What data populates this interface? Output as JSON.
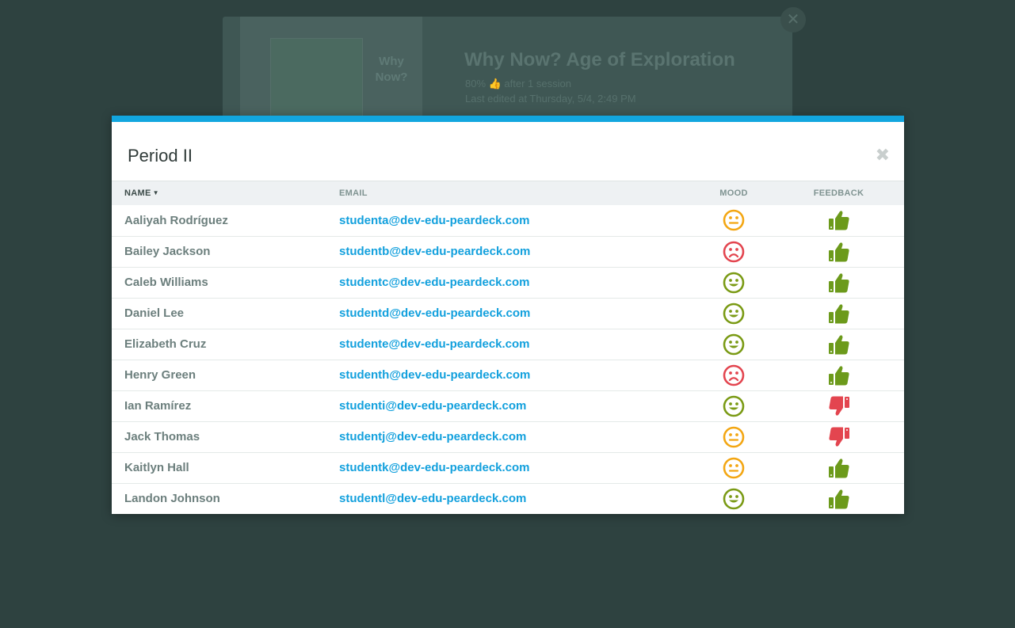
{
  "background": {
    "thumb_label": "Why Now?",
    "title": "Why Now? Age of Exploration",
    "meta_line1": "80% 👍 after 1 session",
    "meta_line2": "Last edited at Thursday, 5/4, 2:49 PM"
  },
  "modal": {
    "title": "Period II",
    "columns": {
      "name": "NAME",
      "email": "EMAIL",
      "mood": "MOOD",
      "feedback": "FEEDBACK"
    },
    "rows": [
      {
        "name": "Aaliyah Rodríguez",
        "email": "studenta@dev-edu-peardeck.com",
        "mood": "neutral",
        "feedback": "up"
      },
      {
        "name": "Bailey Jackson",
        "email": "studentb@dev-edu-peardeck.com",
        "mood": "sad",
        "feedback": "up"
      },
      {
        "name": "Caleb Williams",
        "email": "studentc@dev-edu-peardeck.com",
        "mood": "happy",
        "feedback": "up"
      },
      {
        "name": "Daniel Lee",
        "email": "studentd@dev-edu-peardeck.com",
        "mood": "happy",
        "feedback": "up"
      },
      {
        "name": "Elizabeth Cruz",
        "email": "studente@dev-edu-peardeck.com",
        "mood": "happy",
        "feedback": "up"
      },
      {
        "name": "Henry Green",
        "email": "studenth@dev-edu-peardeck.com",
        "mood": "sad",
        "feedback": "up"
      },
      {
        "name": "Ian Ramírez",
        "email": "studenti@dev-edu-peardeck.com",
        "mood": "happy",
        "feedback": "down"
      },
      {
        "name": "Jack Thomas",
        "email": "studentj@dev-edu-peardeck.com",
        "mood": "neutral",
        "feedback": "down"
      },
      {
        "name": "Kaitlyn Hall",
        "email": "studentk@dev-edu-peardeck.com",
        "mood": "neutral",
        "feedback": "up"
      },
      {
        "name": "Landon Johnson",
        "email": "studentl@dev-edu-peardeck.com",
        "mood": "happy",
        "feedback": "up"
      }
    ]
  },
  "colors": {
    "accent": "#12a6df",
    "mood_happy": "#7a9a14",
    "mood_neutral": "#f3a612",
    "mood_sad": "#e3454f",
    "thumb_up": "#6c9a1b",
    "thumb_down": "#e3454f"
  }
}
